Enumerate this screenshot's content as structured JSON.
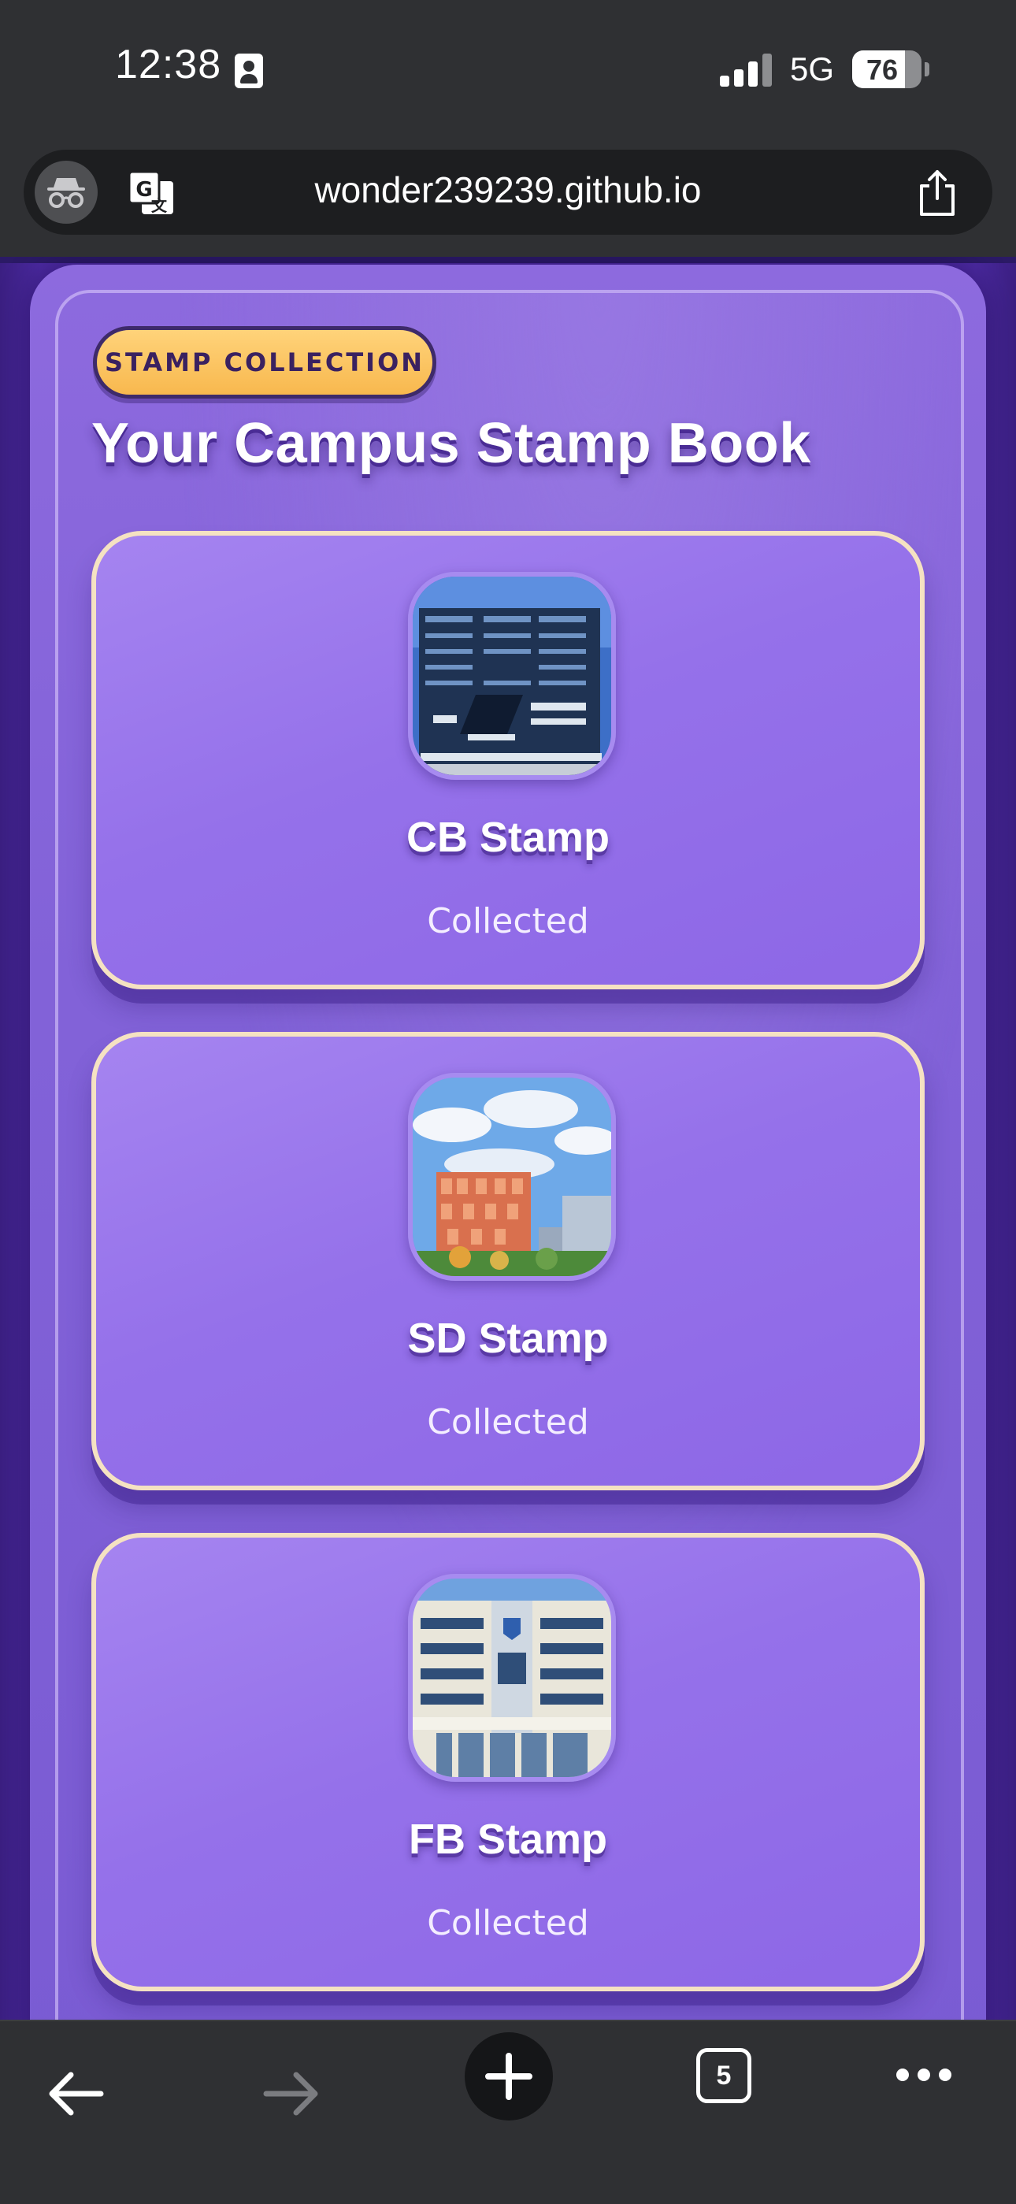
{
  "status_bar": {
    "time": "12:38",
    "network": "5G",
    "battery_level": "76",
    "battery_fraction": 0.76,
    "icons": [
      "contact-card-icon",
      "signal-icon",
      "battery-icon"
    ]
  },
  "browser": {
    "url": "wonder239239.github.io",
    "icons": [
      "incognito-icon",
      "translate-icon",
      "share-icon"
    ],
    "toolbar": {
      "tab_count": "5",
      "icons": [
        "back-arrow-icon",
        "forward-arrow-icon",
        "plus-icon",
        "tabs-icon",
        "more-icon"
      ]
    }
  },
  "page": {
    "badge": "STAMP COLLECTION",
    "title": "Your Campus Stamp Book",
    "stamps": [
      {
        "name": "CB Stamp",
        "status": "Collected",
        "image": "cb-building-photo"
      },
      {
        "name": "SD Stamp",
        "status": "Collected",
        "image": "sd-building-photo"
      },
      {
        "name": "FB Stamp",
        "status": "Collected",
        "image": "fb-building-photo"
      }
    ]
  },
  "colors": {
    "accent_purple": "#8d67e6",
    "badge_yellow": "#ffc862",
    "card_border": "#f5e2c2",
    "chrome_dark": "#2f3033"
  }
}
